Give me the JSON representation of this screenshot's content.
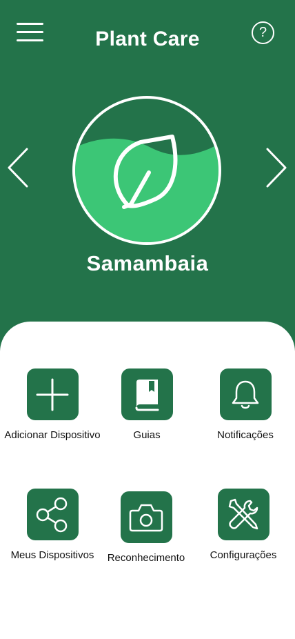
{
  "header": {
    "title": "Plant Care",
    "menu_icon": "hamburger-menu-icon",
    "help_icon": "help-circle-icon",
    "help_label": "?"
  },
  "carousel": {
    "plant_name": "Samambaia",
    "avatar_icon": "leaf-icon",
    "prev_icon": "chevron-left-icon",
    "next_icon": "chevron-right-icon"
  },
  "menu": {
    "items": [
      {
        "label": "Adicionar Dispositivo",
        "icon": "plus-icon"
      },
      {
        "label": "Guias",
        "icon": "book-icon"
      },
      {
        "label": "Notificações",
        "icon": "bell-icon"
      },
      {
        "label": "Meus Dispositivos",
        "icon": "share-icon"
      },
      {
        "label": "Reconhecimento",
        "icon": "camera-icon"
      },
      {
        "label": "Configurações",
        "icon": "tools-icon"
      }
    ]
  },
  "colors": {
    "primary": "#23734a",
    "avatar_fill": "#3cc676",
    "panel": "#ffffff",
    "text_dark": "#111111",
    "text_light": "#ffffff"
  }
}
